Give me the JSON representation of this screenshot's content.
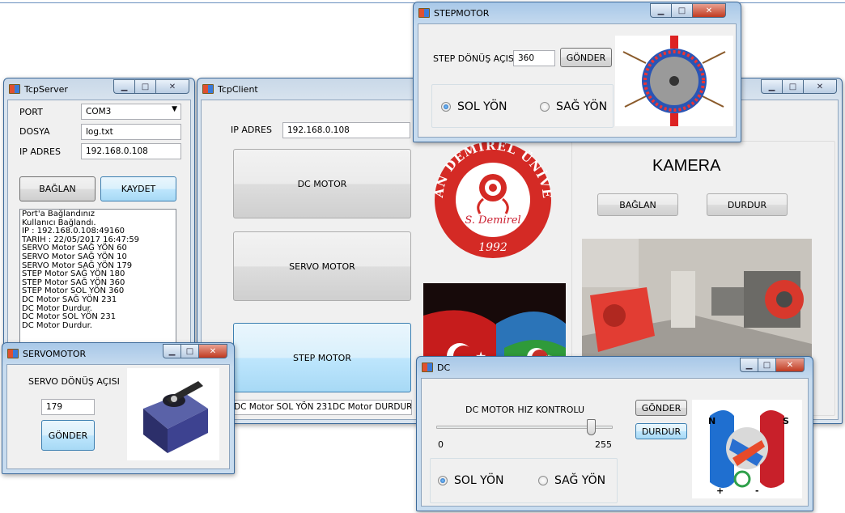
{
  "tcpserver": {
    "title": "TcpServer",
    "port_label": "PORT",
    "port_value": "COM3",
    "file_label": "DOSYA",
    "file_value": "log.txt",
    "ip_label": "IP ADRES",
    "ip_value": "192.168.0.108",
    "connect_btn": "BAĞLAN",
    "save_btn": "KAYDET",
    "log": [
      "Port'a Bağlandınız",
      "Kullanıcı Bağlandı.",
      "IP : 192.168.0.108:49160",
      "TARIH : 22/05/2017 16:47:59",
      "SERVO Motor SAĞ YÖN 60",
      "SERVO Motor SAĞ YÖN 10",
      "SERVO Motor SAĞ YÖN 179",
      "STEP Motor SAĞ YÖN 180",
      "STEP Motor SAĞ YÖN 360",
      "STEP Motor SOL YÖN 360",
      "DC Motor SAĞ YÖN 231",
      "DC Motor Durdur.",
      "DC Motor SOL YÖN 231",
      "DC Motor Durdur."
    ]
  },
  "tcpclient": {
    "title": "TcpClient",
    "ip_label": "IP ADRES",
    "ip_value": "192.168.0.108",
    "dc_btn": "DC MOTOR",
    "servo_btn": "SERVO MOTOR",
    "step_btn": "STEP MOTOR",
    "status_text": "DC Motor SOL YÖN 231DC Motor DURDUR.",
    "logo_top_text": "SÜLEYMAN DEMİREL ÜNİVERSİTESİ",
    "logo_signature": "S. Demirel",
    "logo_year": "1992",
    "camera_title": "KAMERA",
    "camera_connect_btn": "BAĞLAN",
    "camera_stop_btn": "DURDUR"
  },
  "stepmotor": {
    "title": "STEPMOTOR",
    "angle_label": "STEP DÖNÜŞ AÇISI",
    "angle_value": "360",
    "send_btn": "GÖNDER",
    "left_label": "SOL YÖN",
    "right_label": "SAĞ YÖN",
    "selected": "left"
  },
  "servomotor": {
    "title": "SERVOMOTOR",
    "angle_label": "SERVO DÖNÜŞ AÇISI",
    "angle_value": "179",
    "send_btn": "GÖNDER"
  },
  "dc": {
    "title": "DC",
    "speed_label": "DC MOTOR HIZ KONTROLU",
    "slider_min": "0",
    "slider_max": "255",
    "slider_fraction": 0.9,
    "send_btn": "GÖNDER",
    "stop_btn": "DURDUR",
    "left_label": "SOL YÖN",
    "right_label": "SAĞ YÖN",
    "selected": "left",
    "pole_n": "N",
    "pole_s": "S",
    "plus": "+",
    "minus": "-"
  }
}
